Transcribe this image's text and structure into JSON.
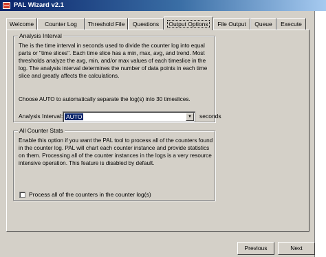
{
  "window": {
    "title": "PAL Wizard v2.1"
  },
  "tabs": [
    {
      "label": "Welcome",
      "active": false
    },
    {
      "label": "Counter Log",
      "active": false
    },
    {
      "label": "Threshold File",
      "active": false
    },
    {
      "label": "Questions",
      "active": false
    },
    {
      "label": "Output Options",
      "active": true
    },
    {
      "label": "File Output",
      "active": false
    },
    {
      "label": "Queue",
      "active": false
    },
    {
      "label": "Execute",
      "active": false
    }
  ],
  "analysis_interval": {
    "group_label": "Analysis Interval",
    "description_lines": [
      "The is the time interval in seconds used to divide the counter log into equal",
      "parts or \"time slices\". Each time slice has a min, max, avg, and trend. Most",
      "thresholds analyze the avg, min, and/or max values of each timeslice in the",
      "log. The analysis interval determines the number of data points in each time",
      "slice and greatly affects the calculations."
    ],
    "auto_note": "Choose AUTO to automatically separate the log(s) into 30 timeslices.",
    "field_label": "Analysis Interval:",
    "field_value": "AUTO",
    "unit_label": "seconds"
  },
  "all_counter_stats": {
    "group_label": "All Counter Stats",
    "description_lines": [
      "Enable this option if you want the PAL tool to process all of the counters found",
      "in the counter log. PAL will chart each counter instance and provide statistics",
      "on them. Processing all of the counter instances in the logs is a very resource",
      "intensive operation. This feature is disabled by default."
    ],
    "checkbox_label": "Process all of the counters in the counter log(s)",
    "checked": false
  },
  "buttons": {
    "previous": "Previous",
    "next": "Next"
  }
}
